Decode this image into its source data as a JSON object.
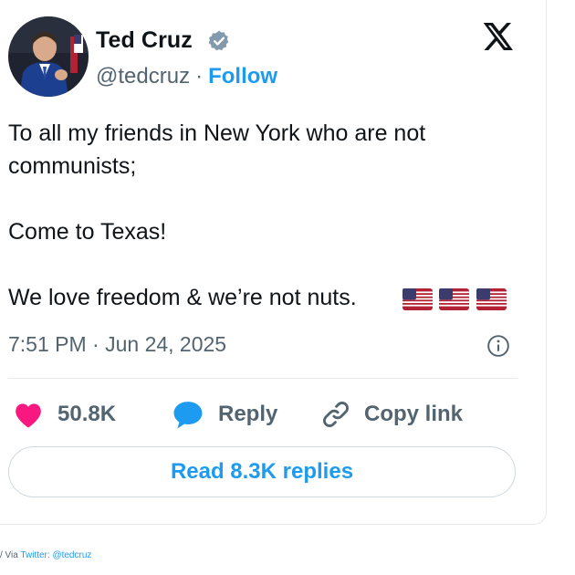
{
  "author": {
    "name": "Ted Cruz",
    "handle": "@tedcruz",
    "separator": "·",
    "follow_label": "Follow",
    "verified_icon": "verified-badge-icon"
  },
  "platform_logo": "x-logo-icon",
  "tweet": {
    "lines": [
      "To all my friends in New York who are not communists;",
      "Come to Texas!",
      "We love freedom & we’re not nuts."
    ],
    "emoji": [
      "us-flag",
      "us-flag",
      "us-flag"
    ],
    "timestamp": "7:51 PM · Jun 24, 2025"
  },
  "actions": {
    "likes": "50.8K",
    "reply_label": "Reply",
    "copy_link_label": "Copy link"
  },
  "read_replies_label": "Read 8.3K replies",
  "credit": {
    "prefix": "/ Via ",
    "link_text": "Twitter: @tedcruz"
  },
  "colors": {
    "accent": "#1d9bf0",
    "like": "#f91880",
    "muted": "#536471",
    "text": "#0f1419"
  }
}
